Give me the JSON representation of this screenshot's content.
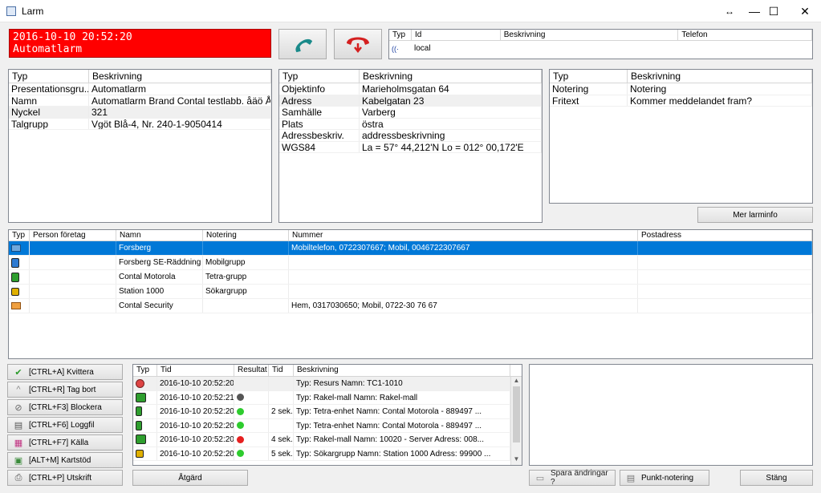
{
  "window": {
    "title": "Larm",
    "restore_symbol": "↔",
    "min_symbol": "—",
    "max_symbol": "☐",
    "close_symbol": "✕"
  },
  "alarm": {
    "datetime": "2016-10-10 20:52:20",
    "name": "Automatlarm",
    "bg_color": "#ff0000"
  },
  "call_table": {
    "headers": [
      "Typ",
      "Id",
      "Beskrivning",
      "Telefon"
    ],
    "rows": [
      {
        "typ_icon": "radio-icon",
        "id": "local",
        "beskrivning": "",
        "telefon": ""
      }
    ]
  },
  "info_left": {
    "headers": [
      "Typ",
      "Beskrivning"
    ],
    "rows": [
      {
        "typ": "Presentationsgru...",
        "beskrivning": "Automatlarm"
      },
      {
        "typ": "Namn",
        "beskrivning": "Automatlarm Brand Contal testlabb. åäö Å..."
      },
      {
        "typ": "Nyckel",
        "beskrivning": "321"
      },
      {
        "typ": "Talgrupp",
        "beskrivning": "Vgöt Blå-4, Nr. 240-1-9050414"
      }
    ]
  },
  "info_mid": {
    "headers": [
      "Typ",
      "Beskrivning"
    ],
    "rows": [
      {
        "typ": "Objektinfo",
        "beskrivning": "Marieholmsgatan 64"
      },
      {
        "typ": "Adress",
        "beskrivning": "Kabelgatan 23"
      },
      {
        "typ": "Samhälle",
        "beskrivning": "Varberg"
      },
      {
        "typ": "Plats",
        "beskrivning": "östra"
      },
      {
        "typ": "Adressbeskriv.",
        "beskrivning": "addressbeskrivning"
      },
      {
        "typ": "WGS84",
        "beskrivning": "La = 57° 44,212'N     Lo = 012° 00,172'E"
      }
    ]
  },
  "info_right": {
    "headers": [
      "Typ",
      "Beskrivning"
    ],
    "rows": [
      {
        "typ": "Notering",
        "beskrivning": "Notering"
      },
      {
        "typ": "Fritext",
        "beskrivning": "Kommer meddelandet fram?"
      }
    ]
  },
  "mer_larminfo": "Mer larminfo",
  "resources": {
    "headers": [
      "Typ",
      "Person företag",
      "Namn",
      "Notering",
      "Nummer",
      "Postadress"
    ],
    "rows": [
      {
        "icon": "person-card-icon",
        "person": "",
        "namn": "Forsberg",
        "notering": "",
        "nummer": "Mobiltelefon, 0722307667; Mobil, 0046722307667",
        "postadress": "",
        "selected": true
      },
      {
        "icon": "tetra-radio-blue-icon",
        "person": "",
        "namn": "Forsberg SE-Räddning",
        "notering": "Mobilgrupp",
        "nummer": "",
        "postadress": "",
        "selected": false
      },
      {
        "icon": "tetra-radio-green-icon",
        "person": "",
        "namn": "Contal Motorola",
        "notering": "Tetra-grupp",
        "nummer": "",
        "postadress": "",
        "selected": false
      },
      {
        "icon": "pager-icon",
        "person": "",
        "namn": "Station 1000",
        "notering": "Sökargrupp",
        "nummer": "",
        "postadress": "",
        "selected": false
      },
      {
        "icon": "person-card-orange-icon",
        "person": "",
        "namn": "Contal Security",
        "notering": "",
        "nummer": "Hem, 0317030650; Mobil, 0722-30 76 67",
        "postadress": "",
        "selected": false
      }
    ]
  },
  "actions": [
    {
      "key": "kvittera",
      "label": "[CTRL+A] Kvittera",
      "icon": "check-icon"
    },
    {
      "key": "tagbort",
      "label": "[CTRL+R] Tag bort",
      "icon": "chevron-up-icon"
    },
    {
      "key": "blockera",
      "label": "[CTRL+F3] Blockera",
      "icon": "block-icon"
    },
    {
      "key": "loggfil",
      "label": "[CTRL+F6] Loggfil",
      "icon": "log-icon"
    },
    {
      "key": "kalla",
      "label": "[CTRL+F7] Källa",
      "icon": "source-icon"
    },
    {
      "key": "kartstod",
      "label": "[ALT+M] Kartstöd",
      "icon": "map-icon"
    },
    {
      "key": "utskrift",
      "label": "[CTRL+P] Utskrift",
      "icon": "printer-icon"
    }
  ],
  "log": {
    "headers": [
      "Typ",
      "Tid",
      "Resultat",
      "Tid",
      "Beskrivning"
    ],
    "rows": [
      {
        "icon": "resource-icon",
        "tid": "2016-10-10 20:52:20",
        "status": "",
        "status_color": "",
        "tid2": "",
        "beskrivning": "Typ: Resurs Namn: TC1-1010"
      },
      {
        "icon": "rakel-icon",
        "tid": "2016-10-10 20:52:21",
        "status": "pending",
        "status_color": "#555555",
        "tid2": "",
        "beskrivning": "Typ: Rakel-mall Namn: Rakel-mall"
      },
      {
        "icon": "tetra-icon",
        "tid": "2016-10-10 20:52:20",
        "status": "ok",
        "status_color": "#2ecc2e",
        "tid2": "2 sek.",
        "beskrivning": "Typ: Tetra-enhet Namn: Contal Motorola - 889497 ..."
      },
      {
        "icon": "tetra-icon",
        "tid": "2016-10-10 20:52:20",
        "status": "ok",
        "status_color": "#2ecc2e",
        "tid2": "",
        "beskrivning": "Typ: Tetra-enhet Namn: Contal Motorola - 889497 ..."
      },
      {
        "icon": "rakel-icon",
        "tid": "2016-10-10 20:52:20",
        "status": "fail",
        "status_color": "#e62020",
        "tid2": "4 sek.",
        "beskrivning": "Typ: Rakel-mall Namn: 10020 - Server Adress: 008..."
      },
      {
        "icon": "pager-icon",
        "tid": "2016-10-10 20:52:20",
        "status": "ok",
        "status_color": "#2ecc2e",
        "tid2": "5 sek.",
        "beskrivning": "Typ: Sökargrupp Namn: Station 1000 Adress: 99900 ..."
      }
    ]
  },
  "atgard": "Åtgärd",
  "spara": "Spara ändringar ?",
  "punkt": "Punkt-notering",
  "stang": "Stäng"
}
